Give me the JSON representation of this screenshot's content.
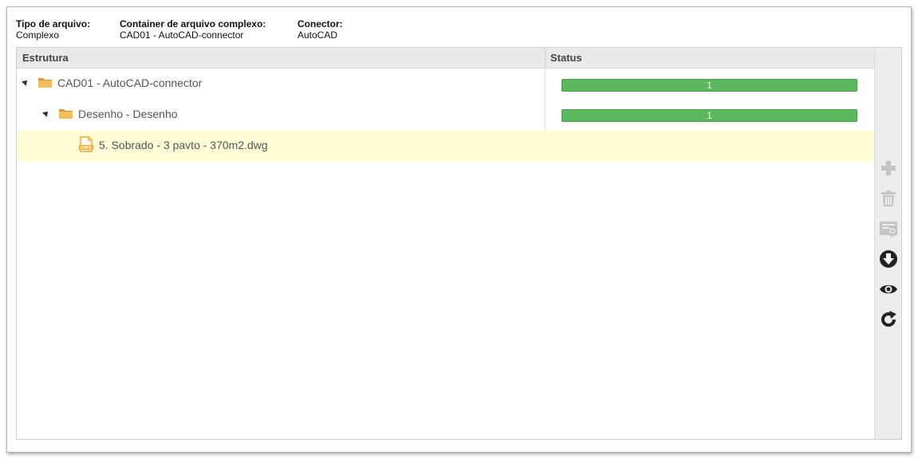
{
  "header": {
    "file_type_label": "Tipo de arquivo:",
    "file_type_value": "Complexo",
    "container_label": "Container de arquivo complexo:",
    "container_value": "CAD01 - AutoCAD-connector",
    "connector_label": "Conector:",
    "connector_value": "AutoCAD"
  },
  "grid": {
    "columns": [
      "Estrutura",
      "Status"
    ],
    "rows": [
      {
        "label": "CAD01 - AutoCAD-connector",
        "status": "1",
        "icon": "folder-icon"
      },
      {
        "label": "Desenho - Desenho",
        "status": "1",
        "icon": "folder-icon"
      },
      {
        "label": "5. Sobrado - 3 pavto - 370m2.dwg",
        "status": "",
        "icon": "dwg-file-icon"
      }
    ],
    "dwg_tag": "DWG"
  },
  "toolbar": {
    "icons": [
      "plus-icon",
      "trash-icon",
      "certificate-icon",
      "download-icon",
      "eye-icon",
      "refresh-icon"
    ]
  },
  "colors": {
    "status_green": "#5cb85c",
    "selected_row": "#fffdd6",
    "folder": "#f0b04c",
    "dwg": "#f5a623",
    "disabled_icon": "#c4c4c4",
    "active_icon": "#222222"
  }
}
